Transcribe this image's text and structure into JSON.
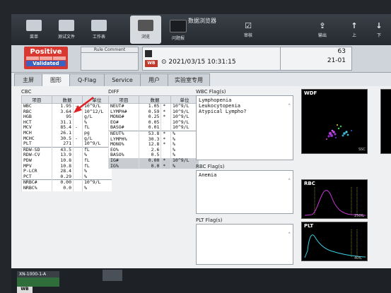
{
  "toolbar": {
    "buttons": [
      {
        "label": "菜单"
      },
      {
        "label": "测试文件"
      },
      {
        "label": "工作表"
      }
    ],
    "screen_title": "数据浏览器",
    "mid_buttons": [
      {
        "label": "浏览"
      },
      {
        "label": "问题报"
      }
    ],
    "verify_label": "审核",
    "output_label": "输出",
    "up_label": "上",
    "down_label": "下"
  },
  "status": {
    "positive_label": "Positive",
    "validated_label": "Validated",
    "rule_comment_label": "Rule Comment",
    "datetime": "2021/03/15 10:31:15",
    "wb_label": "WB",
    "sample_num": "63",
    "rack_pos": "21-01"
  },
  "tabs": [
    {
      "label": "主屏"
    },
    {
      "label": "图形"
    },
    {
      "label": "Q-Flag"
    },
    {
      "label": "Service"
    },
    {
      "label": "用户"
    },
    {
      "label": "实验室专用"
    }
  ],
  "cbc": {
    "title": "CBC",
    "headers": [
      "项目",
      "数据",
      "单位"
    ],
    "rows": [
      {
        "name": "WBC",
        "value": "1.95",
        "flag": "-",
        "unit": "10^9/L"
      },
      {
        "name": "RBC",
        "value": "3.64",
        "flag": "",
        "unit": "10^12/L"
      },
      {
        "name": "HGB",
        "value": "95",
        "flag": "",
        "unit": "g/L"
      },
      {
        "name": "HCT",
        "value": "31.1",
        "flag": "",
        "unit": "%"
      },
      {
        "name": "MCV",
        "value": "85.4",
        "flag": "-",
        "unit": "fL"
      },
      {
        "name": "MCH",
        "value": "26.1",
        "flag": "",
        "unit": "pg"
      },
      {
        "name": "MCHC",
        "value": "30.5",
        "flag": "-",
        "unit": "g/L"
      },
      {
        "name": "PLT",
        "value": "271",
        "flag": "",
        "unit": "10^9/L"
      },
      {
        "name": "RDW-SD",
        "value": "43.5",
        "flag": "",
        "unit": "fL"
      },
      {
        "name": "RDW-CV",
        "value": "13.9",
        "flag": "",
        "unit": "%"
      },
      {
        "name": "PDW",
        "value": "10.8",
        "flag": "",
        "unit": "fL"
      },
      {
        "name": "MPV",
        "value": "10.8",
        "flag": "",
        "unit": "fL"
      },
      {
        "name": "P-LCR",
        "value": "28.4",
        "flag": "",
        "unit": "%"
      },
      {
        "name": "PCT",
        "value": "0.29",
        "flag": "",
        "unit": "%"
      },
      {
        "name": "NRBC#",
        "value": "0.00",
        "flag": "",
        "unit": "10^9/L"
      },
      {
        "name": "NRBC%",
        "value": "0.0",
        "flag": "",
        "unit": "%"
      }
    ]
  },
  "diff": {
    "title": "DIFF",
    "headers": [
      "项目",
      "数据",
      "单位"
    ],
    "rows": [
      {
        "name": "NEUT#",
        "value": "1.05",
        "flag": "*",
        "unit": "10^9/L"
      },
      {
        "name": "LYMPH#",
        "value": "0.59",
        "flag": "*",
        "unit": "10^9/L"
      },
      {
        "name": "MONO#",
        "value": "0.25",
        "flag": "*",
        "unit": "10^9/L"
      },
      {
        "name": "EO#",
        "value": "0.05",
        "flag": "",
        "unit": "10^9/L"
      },
      {
        "name": "BASO#",
        "value": "0.01",
        "flag": "",
        "unit": "10^9/L"
      },
      {
        "name": "NEUT%",
        "value": "53.8",
        "flag": "*",
        "unit": "%"
      },
      {
        "name": "LYMPH%",
        "value": "30.3",
        "flag": "*",
        "unit": "%"
      },
      {
        "name": "MONO%",
        "value": "12.8",
        "flag": "*",
        "unit": "%"
      },
      {
        "name": "EO%",
        "value": "2.6",
        "flag": "",
        "unit": "%"
      },
      {
        "name": "BASO%",
        "value": "0.5",
        "flag": "",
        "unit": "%"
      },
      {
        "name": "IG#",
        "value": "0.00",
        "flag": "*",
        "unit": "10^9/L"
      },
      {
        "name": "IG%",
        "value": "0.0",
        "flag": "*",
        "unit": "%"
      }
    ]
  },
  "flags": {
    "wbc_title": "WBC Flag(s)",
    "wbc_items": [
      "Lymphopenia",
      "Leukocytopenia",
      "Atypical Lympho?"
    ],
    "rbc_title": "RBC Flag(s)",
    "rbc_items": [
      "Anemia"
    ],
    "plt_title": "PLT Flag(s)",
    "plt_items": []
  },
  "plots": {
    "wdf_label": "WDF",
    "wdf_axis": "SSC",
    "rbc_label": "RBC",
    "rbc_axis": "250fL",
    "plt_label": "PLT",
    "plt_axis": "40fL"
  },
  "device": {
    "name": "XN-1000-1-A",
    "tab_label": "WB"
  }
}
